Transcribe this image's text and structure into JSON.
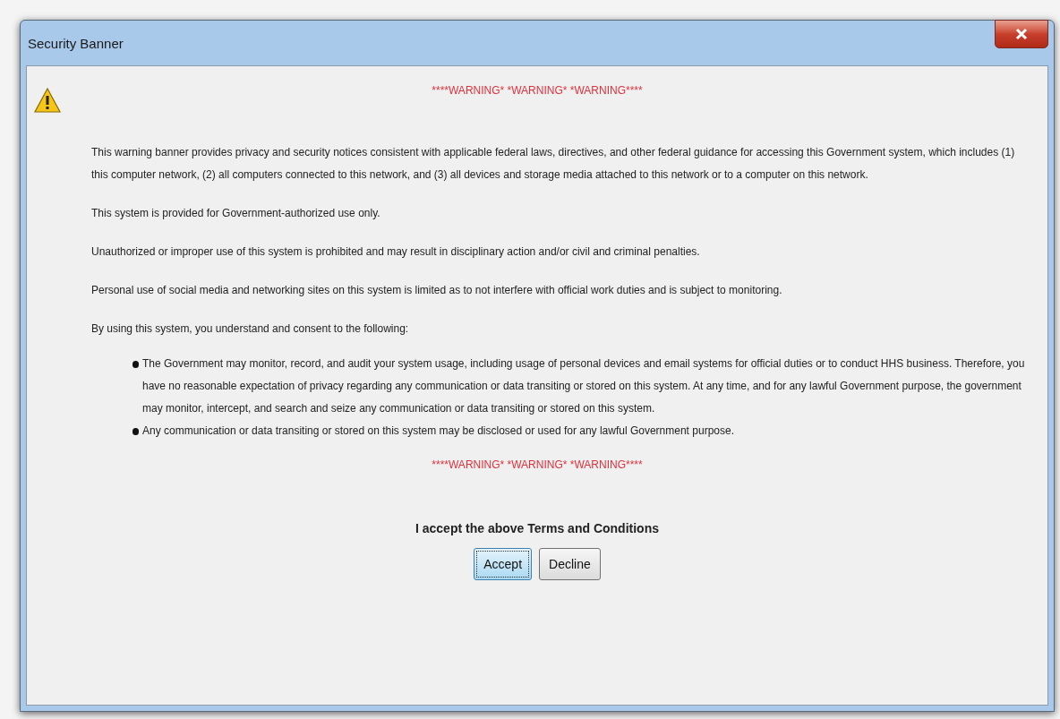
{
  "window": {
    "title": "Security Banner"
  },
  "warning_top": "****WARNING* *WARNING* *WARNING****",
  "paragraphs": [
    "This warning banner provides privacy and security notices consistent with applicable federal laws, directives, and other federal guidance for accessing this Government system, which includes (1) this computer network, (2) all computers connected to this network, and (3) all devices and storage media attached to this network or to a computer on this network.",
    "This system is provided for Government-authorized use only.",
    "Unauthorized or improper use of this system is prohibited and may result in disciplinary action and/or civil and criminal penalties.",
    "Personal use of social media and networking sites on this system is limited as to not interfere with official work duties and is subject to monitoring.",
    "By using this system, you understand and consent to the following:"
  ],
  "bullets": [
    "The Government may monitor, record, and audit your system usage, including usage of personal devices and email systems for official duties or to conduct HHS business. Therefore, you have no reasonable expectation of privacy regarding any communication or data transiting or stored on this system. At any time, and for any lawful Government purpose, the government may monitor, intercept, and search and seize any communication or data transiting or stored on this system.",
    "Any communication or data transiting or stored on this system may be disclosed or used for any lawful Government purpose."
  ],
  "warning_bottom": "****WARNING* *WARNING* *WARNING****",
  "accept_prompt": "I accept the above Terms and Conditions",
  "buttons": [
    {
      "label": "Accept",
      "focused": true
    },
    {
      "label": "Decline",
      "focused": false
    }
  ]
}
